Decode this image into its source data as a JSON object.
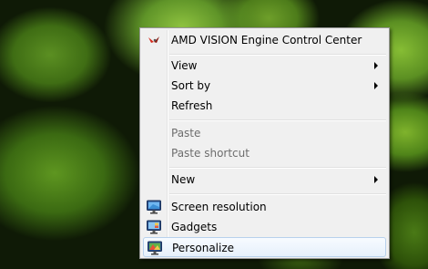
{
  "context_menu": {
    "items": [
      {
        "label": "AMD VISION Engine Control Center",
        "icon": "amd-vision-icon"
      },
      {
        "label": "View",
        "submenu": true
      },
      {
        "label": "Sort by",
        "submenu": true
      },
      {
        "label": "Refresh"
      },
      {
        "label": "Paste",
        "disabled": true
      },
      {
        "label": "Paste shortcut",
        "disabled": true
      },
      {
        "label": "New",
        "submenu": true
      },
      {
        "label": "Screen resolution",
        "icon": "monitor-icon"
      },
      {
        "label": "Gadgets",
        "icon": "gadgets-icon"
      },
      {
        "label": "Personalize",
        "icon": "personalize-icon",
        "highlighted": true
      }
    ]
  }
}
